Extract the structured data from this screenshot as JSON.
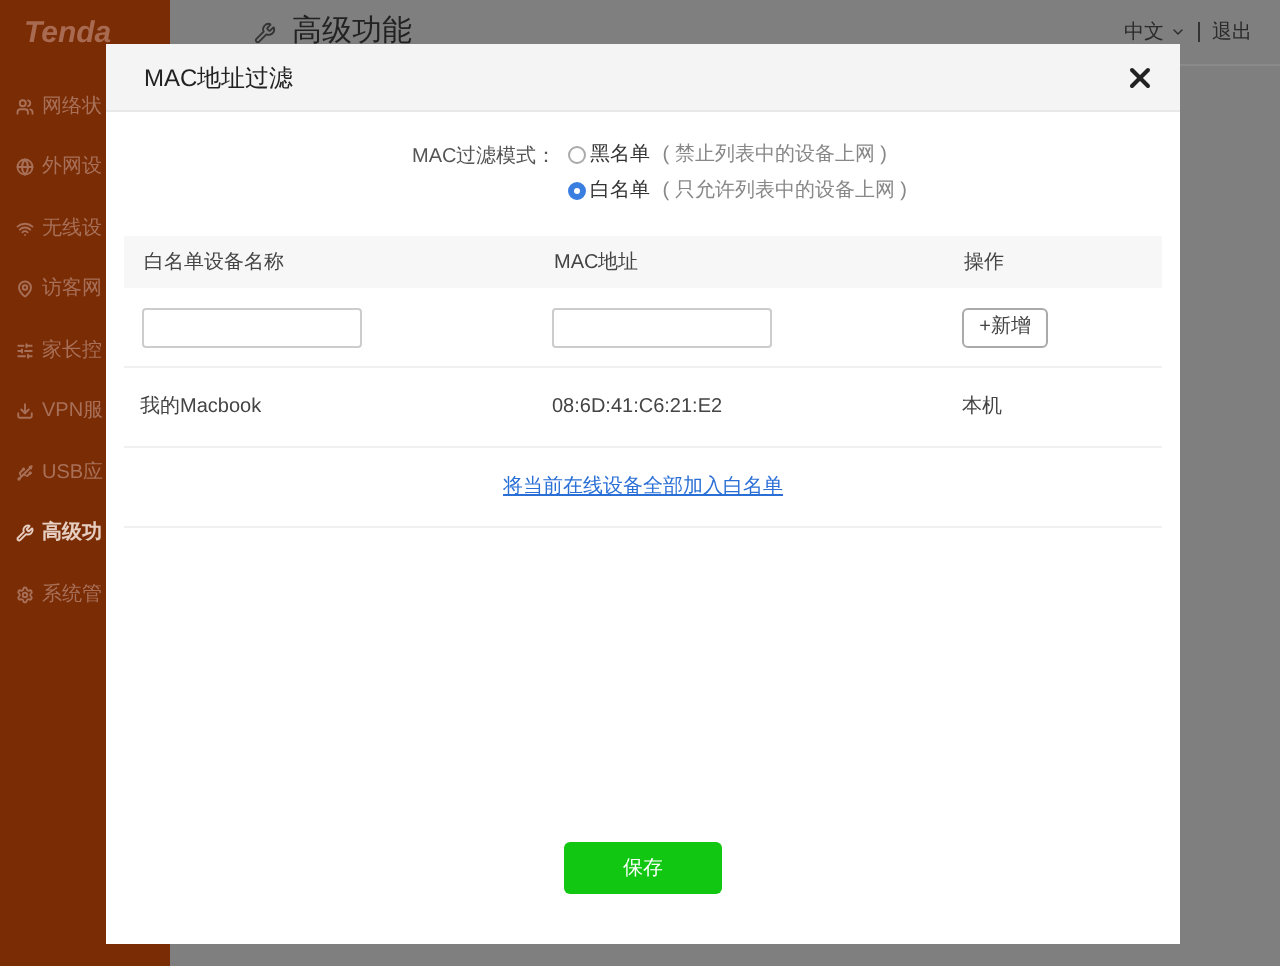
{
  "sidebar": {
    "logo": "Tenda",
    "items": [
      {
        "label": "网络状",
        "selected": false
      },
      {
        "label": "外网设",
        "selected": false
      },
      {
        "label": "无线设",
        "selected": false
      },
      {
        "label": "访客网",
        "selected": false
      },
      {
        "label": "家长控",
        "selected": false
      },
      {
        "label": "VPN服",
        "selected": false
      },
      {
        "label": "USB应",
        "selected": false
      },
      {
        "label": "高级功",
        "selected": true
      },
      {
        "label": "系统管",
        "selected": false
      }
    ]
  },
  "header": {
    "title": "高级功能",
    "language": "中文",
    "logout": "退出"
  },
  "dialog": {
    "title": "MAC地址过滤",
    "mode_label": "MAC过滤模式：",
    "modes": [
      {
        "label": "黑名单",
        "hint": "( 禁止列表中的设备上网 )",
        "selected": false
      },
      {
        "label": "白名单",
        "hint": "( 只允许列表中的设备上网 )",
        "selected": true
      }
    ],
    "table": {
      "columns": [
        "白名单设备名称",
        "MAC地址",
        "操作"
      ],
      "add_button": "+新增",
      "rows": [
        {
          "name": "我的Macbook",
          "mac": "08:6D:41:C6:21:E2",
          "action": "本机"
        }
      ]
    },
    "add_all_link": "将当前在线设备全部加入白名单",
    "save_button": "保存"
  }
}
